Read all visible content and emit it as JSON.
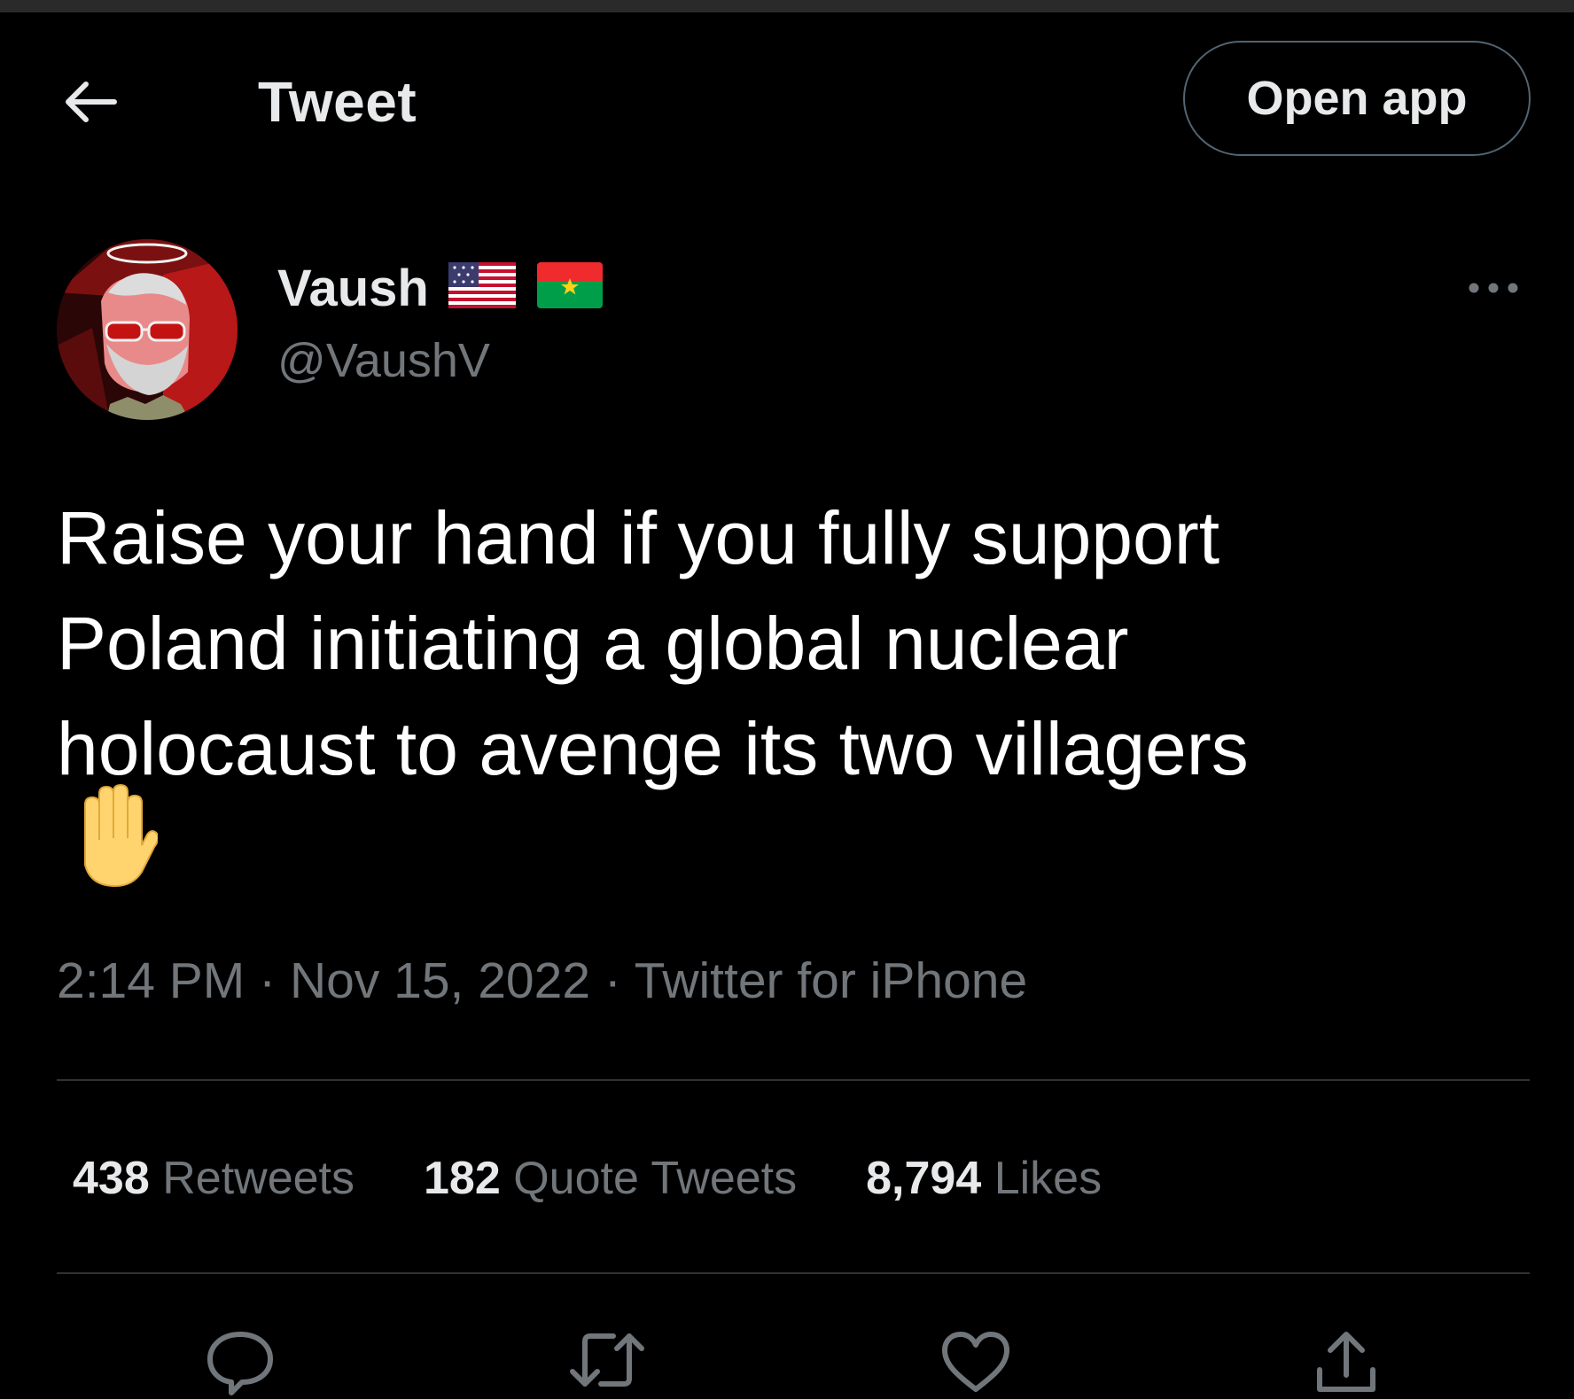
{
  "header": {
    "back_icon": "arrow-left-icon",
    "title": "Tweet",
    "open_app_label": "Open app"
  },
  "author": {
    "display_name": "Vaush",
    "handle": "@VaushV",
    "badges": [
      "flag-us-icon",
      "flag-burkina-faso-icon"
    ],
    "avatar": "avatar-illustration"
  },
  "more_icon": "more-horizontal-icon",
  "tweet": {
    "lines": [
      "Raise your hand if you fully support",
      "Poland initiating a global nuclear",
      "holocaust to avenge its two villagers"
    ],
    "emoji": "raised-hand-emoji",
    "time": "2:14 PM",
    "sep1": " · ",
    "date": "Nov 15, 2022",
    "sep2": " · ",
    "source": "Twitter for iPhone"
  },
  "stats": {
    "retweets_count": "438",
    "retweets_label": "Retweets",
    "quotes_count": "182",
    "quotes_label": "Quote Tweets",
    "likes_count": "8,794",
    "likes_label": "Likes"
  },
  "actions": [
    "reply-icon",
    "retweet-icon",
    "like-icon",
    "share-icon"
  ],
  "colors": {
    "background": "#000000",
    "primary_text": "#e7e9ea",
    "secondary_text": "#71767b",
    "divider": "#2f3336",
    "button_border": "#536471"
  }
}
